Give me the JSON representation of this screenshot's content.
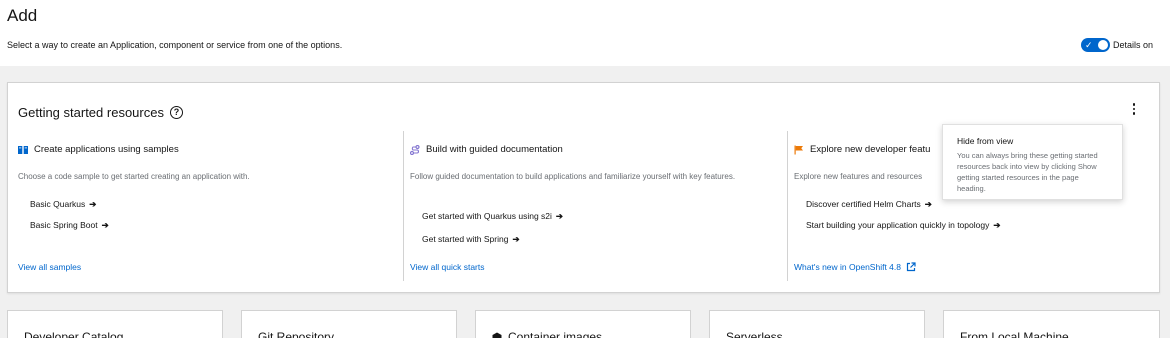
{
  "header": {
    "title": "Add",
    "description": "Select a way to create an Application, component or service from one of the options.",
    "details_toggle": {
      "label": "Details on",
      "state": "on"
    }
  },
  "getting_started": {
    "title": "Getting started resources",
    "columns": [
      {
        "icon": "book-icon",
        "heading": "Create applications using samples",
        "description": "Choose a code sample to get started creating an application with.",
        "links": [
          "Basic Quarkus",
          "Basic Spring Boot"
        ],
        "footer": "View all samples"
      },
      {
        "icon": "route-icon",
        "heading": "Build with guided documentation",
        "description": "Follow guided documentation to build applications and familiarize yourself with key features.",
        "links": [
          "Get started with Quarkus using s2i",
          "Get started with Spring"
        ],
        "footer": "View all quick starts"
      },
      {
        "icon": "flag-icon",
        "heading": "Explore new developer featu",
        "description": "Explore new features and resources",
        "links": [
          "Discover certified Helm Charts",
          "Start building your application quickly in topology"
        ],
        "footer": "What's new in OpenShift 4.8"
      }
    ],
    "tooltip": {
      "title": "Hide from view",
      "body": "You can always bring these getting started resources back into view by clicking Show getting started resources in the page heading."
    }
  },
  "options": [
    {
      "title": "Developer Catalog"
    },
    {
      "title": "Git Repository"
    },
    {
      "title": "Container images"
    },
    {
      "title": "Serverless"
    },
    {
      "title": "From Local Machine"
    }
  ],
  "colors": {
    "accent": "#0066cc",
    "flag": "#ec7a08",
    "text": "#151515",
    "muted": "#6a6e73"
  }
}
